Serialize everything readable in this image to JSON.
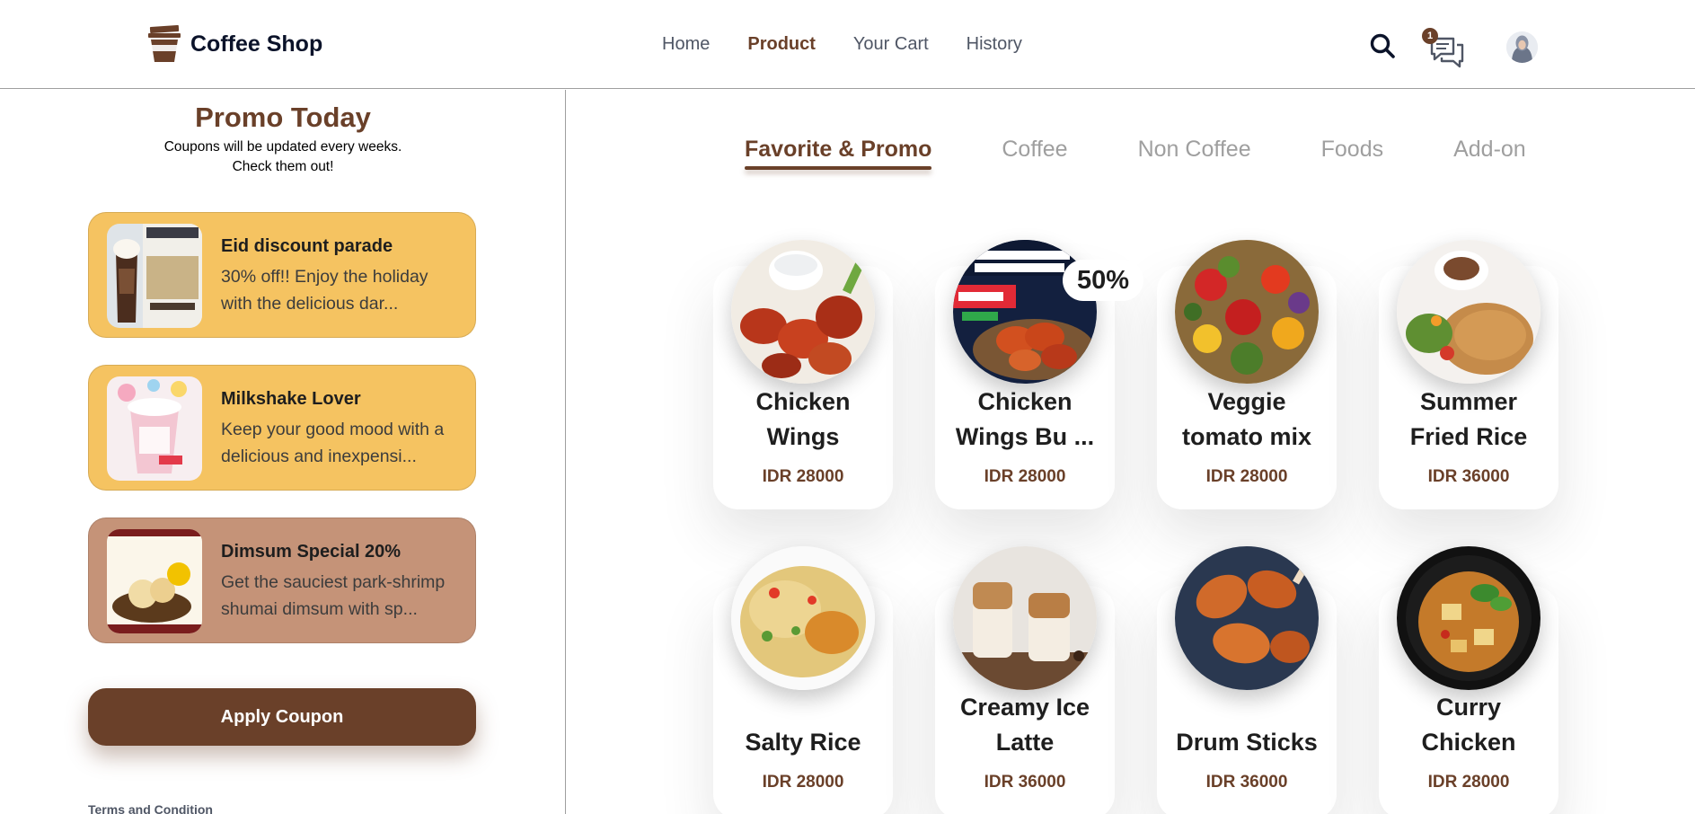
{
  "header": {
    "logo_text": "Coffee Shop",
    "nav": [
      "Home",
      "Product",
      "Your Cart",
      "History"
    ],
    "active_nav": "Product",
    "chat_badge_count": "1"
  },
  "sidebar": {
    "title": "Promo Today",
    "subtitle_line1": "Coupons will be updated every weeks.",
    "subtitle_line2": "Check them out!",
    "coupons": [
      {
        "title": "Eid discount parade",
        "description": "30% off!! Enjoy the holiday with the delicious dar...",
        "bg": "#F5C361",
        "image": "chocolate-frappe-image"
      },
      {
        "title": "Milkshake Lover",
        "description": "Keep your good mood with a delicious and inexpensi...",
        "bg": "#F5C361",
        "image": "milkshake-image"
      },
      {
        "title": "Dimsum Special 20%",
        "description": "Get the sauciest park-shrimp shumai dimsum with sp...",
        "bg": "#C59378",
        "image": "dimsum-image"
      }
    ],
    "apply_button": "Apply Coupon",
    "terms": "Terms and Condition"
  },
  "main": {
    "tabs": [
      "Favorite & Promo",
      "Coffee",
      "Non Coffee",
      "Foods",
      "Add-on"
    ],
    "active_tab": "Favorite & Promo",
    "discount_badge": "50%",
    "products": [
      {
        "name_lines": [
          "Chicken",
          "Wings"
        ],
        "price": "IDR 28000"
      },
      {
        "name_lines": [
          "Chicken",
          "Wings Bu ..."
        ],
        "price": "IDR 28000"
      },
      {
        "name_lines": [
          "Veggie",
          "tomato mix"
        ],
        "price": "IDR 28000"
      },
      {
        "name_lines": [
          "Summer",
          "Fried Rice"
        ],
        "price": "IDR 36000"
      },
      {
        "name_lines": [
          "Salty Rice"
        ],
        "price": "IDR 28000"
      },
      {
        "name_lines": [
          "Creamy Ice",
          "Latte"
        ],
        "price": "IDR 36000"
      },
      {
        "name_lines": [
          "Drum Sticks"
        ],
        "price": "IDR 36000"
      },
      {
        "name_lines": [
          "Curry",
          "Chicken"
        ],
        "price": "IDR 28000"
      }
    ]
  },
  "colors": {
    "brand_brown": "#6A4029",
    "promo_yellow": "#F5C361",
    "promo_tan": "#C59378"
  }
}
